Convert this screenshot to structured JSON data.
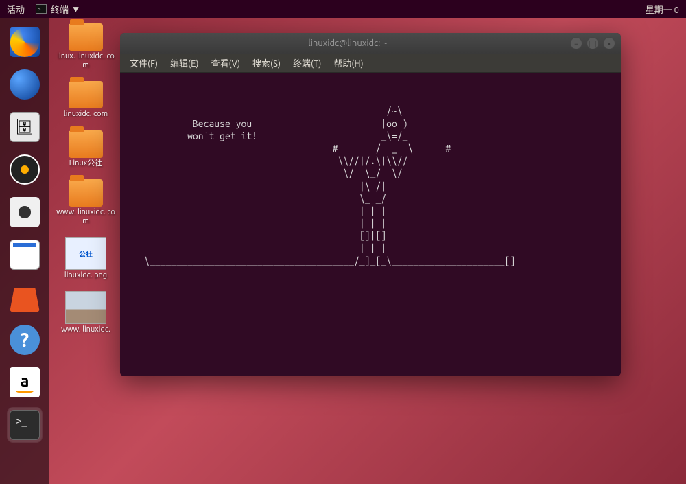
{
  "top_panel": {
    "activities": "活动",
    "app_name": "终端",
    "clock": "星期一 0"
  },
  "dock": {
    "items": [
      {
        "name": "firefox"
      },
      {
        "name": "thunderbird"
      },
      {
        "name": "files"
      },
      {
        "name": "rhythmbox"
      },
      {
        "name": "camera"
      },
      {
        "name": "libreoffice-writer"
      },
      {
        "name": "ubuntu-software"
      },
      {
        "name": "help"
      },
      {
        "name": "amazon"
      },
      {
        "name": "terminal",
        "active": true
      }
    ]
  },
  "desktop": {
    "icons": [
      {
        "type": "folder",
        "label": "linux.\nlinuxidc.\ncom"
      },
      {
        "type": "folder",
        "label": "linuxidc.\ncom"
      },
      {
        "type": "folder",
        "label": "Linux公社"
      },
      {
        "type": "folder",
        "label": "www.\nlinuxidc.\ncom"
      },
      {
        "type": "img-blue",
        "label": "linuxidc.\npng",
        "thumb": "公社"
      },
      {
        "type": "img-photo",
        "label": "www.\nlinuxidc."
      }
    ]
  },
  "terminal": {
    "title": "linuxidc@linuxidc: ~",
    "menu": [
      "文件(F)",
      "编辑(E)",
      "查看(V)",
      "搜索(S)",
      "终端(T)",
      "帮助(H)"
    ],
    "ascii": "\n\n                                                 /~\\\n             Because you                        |oo )\n            won't get it!                       _\\=/_\n                                       #       /  _  \\      #\n                                        \\\\//|/.\\|\\\\//\n                                         \\/  \\_/  \\/\n                                            |\\ /|\n                                            \\_ _/\n                                            | | |\n                                            | | |\n                                            []|[]\n                                            | | |\n    \\______________________________________/_]_[_\\_____________________[]\n"
  }
}
